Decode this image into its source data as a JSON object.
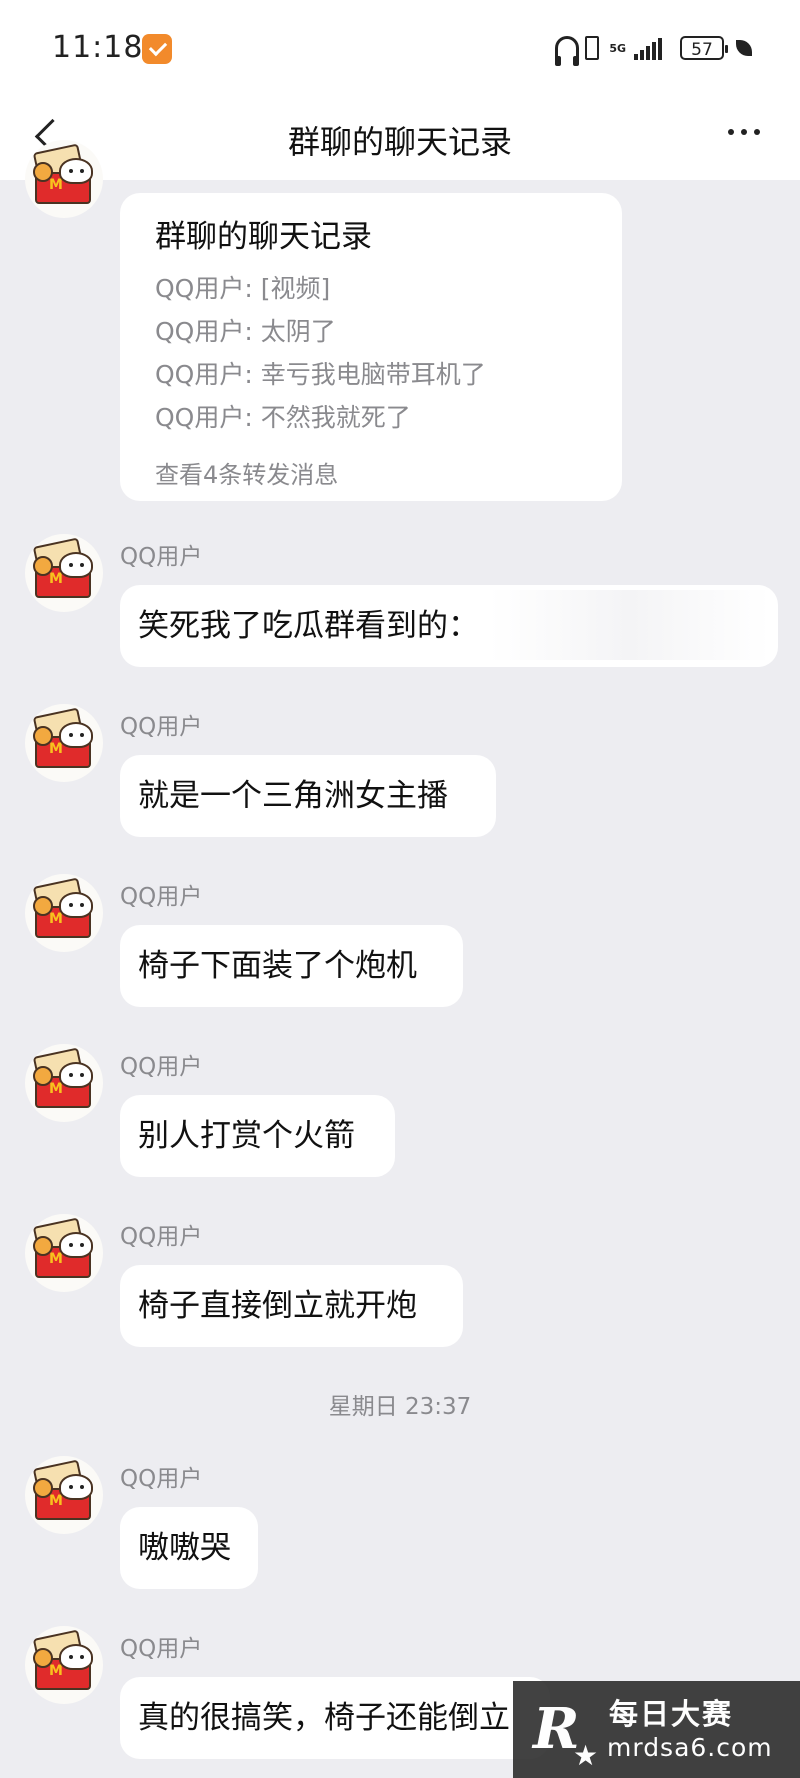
{
  "status_bar": {
    "time": "11:18",
    "network": "5G",
    "battery": "57"
  },
  "nav": {
    "title": "群聊的聊天记录"
  },
  "forward_card": {
    "title": "群聊的聊天记录",
    "lines": [
      "QQ用户: [视频]",
      "QQ用户: 太阴了",
      "QQ用户: 幸亏我电脑带耳机了",
      "QQ用户: 不然我就死了"
    ],
    "footer": "查看4条转发消息"
  },
  "messages": [
    {
      "sender": "QQ用户",
      "text": "笑死我了吃瓜群看到的："
    },
    {
      "sender": "QQ用户",
      "text": "就是一个三角洲女主播"
    },
    {
      "sender": "QQ用户",
      "text": "椅子下面装了个炮机"
    },
    {
      "sender": "QQ用户",
      "text": "别人打赏个火箭"
    },
    {
      "sender": "QQ用户",
      "text": "椅子直接倒立就开炮"
    },
    {
      "sender": "QQ用户",
      "text": "嗷嗷哭"
    },
    {
      "sender": "QQ用户",
      "text": "真的很搞笑，椅子还能倒立"
    }
  ],
  "timestamp": "星期日 23:37",
  "watermark": {
    "title": "每日大赛",
    "url": "mrdsa6.com",
    "logo": "R"
  }
}
